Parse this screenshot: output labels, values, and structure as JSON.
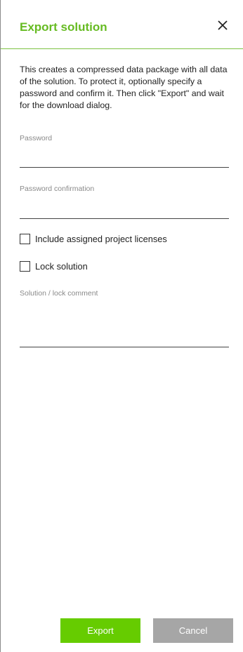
{
  "dialog": {
    "title": "Export solution",
    "close_icon": "close-icon",
    "description": "This creates a compressed data package with all data of the solution. To protect it, optionally specify a password and confirm it. Then click \"Export\" and wait for the download dialog."
  },
  "fields": {
    "password_label": "Password",
    "password_value": "",
    "password_confirmation_label": "Password confirmation",
    "password_confirmation_value": "",
    "include_licenses_label": "Include assigned project licenses",
    "include_licenses_checked": false,
    "lock_solution_label": "Lock solution",
    "lock_solution_checked": false,
    "comment_label": "Solution / lock comment",
    "comment_value": ""
  },
  "buttons": {
    "export_label": "Export",
    "cancel_label": "Cancel"
  },
  "colors": {
    "accent": "#66bb22",
    "export_button": "#66cc00",
    "cancel_button": "#a6a6a6"
  }
}
